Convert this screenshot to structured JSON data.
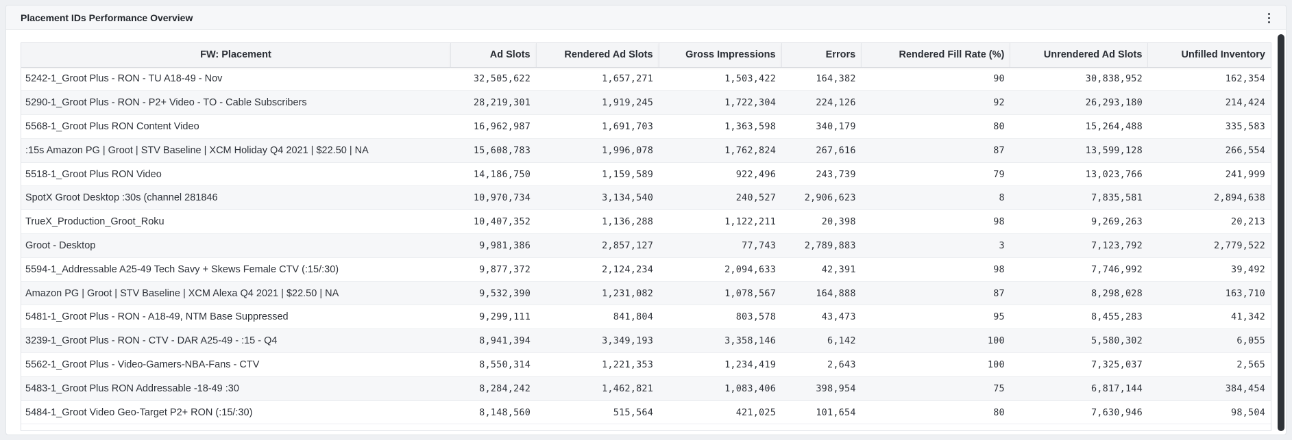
{
  "panel": {
    "title": "Placement IDs Performance Overview",
    "menu_icon": "kebab-menu-icon"
  },
  "table": {
    "columns": [
      "FW: Placement",
      "Ad Slots",
      "Rendered Ad Slots",
      "Gross Impressions",
      "Errors",
      "Rendered Fill Rate (%)",
      "Unrendered Ad Slots",
      "Unfilled Inventory"
    ],
    "rows": [
      [
        "5242-1_Groot Plus - RON - TU A18-49 - Nov",
        "32,505,622",
        "1,657,271",
        "1,503,422",
        "164,382",
        "90",
        "30,838,952",
        "162,354"
      ],
      [
        "5290-1_Groot Plus - RON - P2+ Video - TO - Cable Subscribers",
        "28,219,301",
        "1,919,245",
        "1,722,304",
        "224,126",
        "92",
        "26,293,180",
        "214,424"
      ],
      [
        "5568-1_Groot Plus RON Content Video",
        "16,962,987",
        "1,691,703",
        "1,363,598",
        "340,179",
        "80",
        "15,264,488",
        "335,583"
      ],
      [
        ":15s Amazon PG | Groot | STV Baseline | XCM Holiday Q4 2021 | $22.50 | NA",
        "15,608,783",
        "1,996,078",
        "1,762,824",
        "267,616",
        "87",
        "13,599,128",
        "266,554"
      ],
      [
        "5518-1_Groot Plus RON Video",
        "14,186,750",
        "1,159,589",
        "922,496",
        "243,739",
        "79",
        "13,023,766",
        "241,999"
      ],
      [
        "SpotX Groot Desktop :30s (channel 281846",
        "10,970,734",
        "3,134,540",
        "240,527",
        "2,906,623",
        "8",
        "7,835,581",
        "2,894,638"
      ],
      [
        "TrueX_Production_Groot_Roku",
        "10,407,352",
        "1,136,288",
        "1,122,211",
        "20,398",
        "98",
        "9,269,263",
        "20,213"
      ],
      [
        "Groot - Desktop",
        "9,981,386",
        "2,857,127",
        "77,743",
        "2,789,883",
        "3",
        "7,123,792",
        "2,779,522"
      ],
      [
        "5594-1_Addressable A25-49 Tech Savy + Skews Female CTV (:15/:30)",
        "9,877,372",
        "2,124,234",
        "2,094,633",
        "42,391",
        "98",
        "7,746,992",
        "39,492"
      ],
      [
        "Amazon PG | Groot | STV Baseline | XCM Alexa Q4 2021 | $22.50 | NA",
        "9,532,390",
        "1,231,082",
        "1,078,567",
        "164,888",
        "87",
        "8,298,028",
        "163,710"
      ],
      [
        "5481-1_Groot Plus - RON - A18-49, NTM Base Suppressed",
        "9,299,111",
        "841,804",
        "803,578",
        "43,473",
        "95",
        "8,455,283",
        "41,342"
      ],
      [
        "3239-1_Groot Plus - RON - CTV - DAR A25-49 - :15 - Q4",
        "8,941,394",
        "3,349,193",
        "3,358,146",
        "6,142",
        "100",
        "5,580,302",
        "6,055"
      ],
      [
        "5562-1_Groot Plus - Video-Gamers-NBA-Fans - CTV",
        "8,550,314",
        "1,221,353",
        "1,234,419",
        "2,643",
        "100",
        "7,325,037",
        "2,565"
      ],
      [
        "5483-1_Groot Plus RON Addressable -18-49 :30",
        "8,284,242",
        "1,462,821",
        "1,083,406",
        "398,954",
        "75",
        "6,817,144",
        "384,454"
      ],
      [
        "5484-1_Groot Video Geo-Target P2+ RON (:15/:30)",
        "8,148,560",
        "515,564",
        "421,025",
        "101,654",
        "80",
        "7,630,946",
        "98,504"
      ]
    ]
  }
}
